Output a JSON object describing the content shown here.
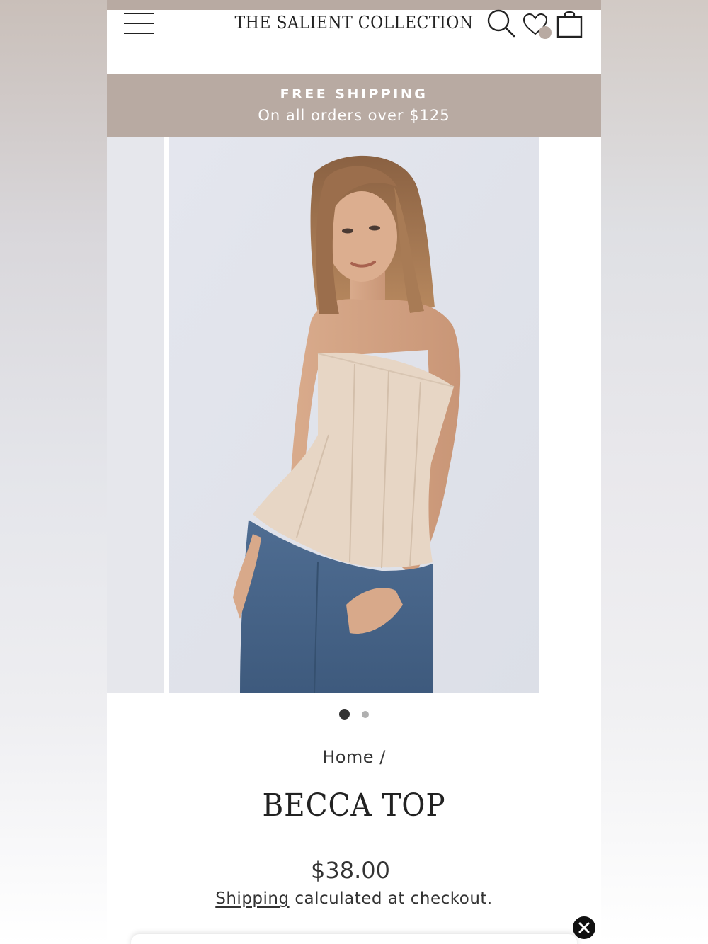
{
  "header": {
    "brand_name": "THE SALIENT COLLECTION",
    "menu_icon": "hamburger-menu-icon",
    "search_icon": "search-icon",
    "wishlist_icon": "heart-icon",
    "cart_icon": "shopping-bag-icon"
  },
  "announcement": {
    "title": "FREE SHIPPING",
    "subtitle": "On all orders over $125"
  },
  "gallery": {
    "slide_count": 2,
    "active_slide": 1,
    "zoom_icon": "magnifier-icon"
  },
  "breadcrumb": {
    "home_label": "Home",
    "separator": "/"
  },
  "product": {
    "title": "BECCA TOP",
    "price": "$38.00",
    "shipping_link": "Shipping",
    "shipping_rest": " calculated at checkout."
  },
  "popup": {
    "close_icon": "close-x-icon"
  },
  "colors": {
    "brand_taupe": "#b8aaa2",
    "text_dark": "#222222",
    "dot_active": "#333333",
    "dot_inactive": "#b0b0b0"
  }
}
